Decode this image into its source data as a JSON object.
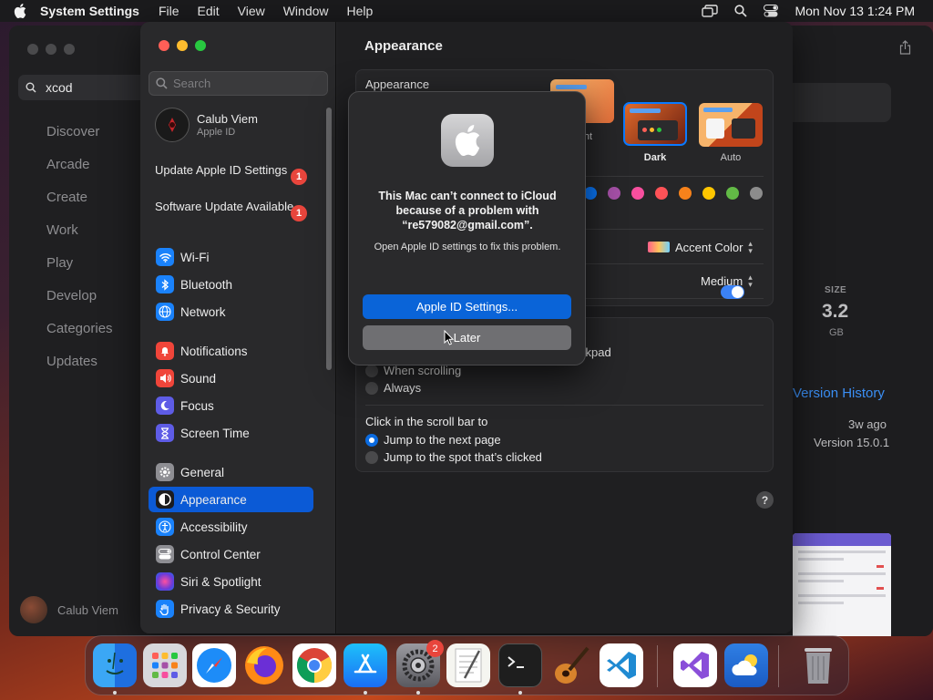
{
  "menubar": {
    "app_name": "System Settings",
    "items": [
      "File",
      "Edit",
      "View",
      "Window",
      "Help"
    ],
    "clock": "Mon Nov 13  1:24 PM"
  },
  "appstore": {
    "search_value": "xcod",
    "nav": [
      "Discover",
      "Arcade",
      "Create",
      "Work",
      "Play",
      "Develop",
      "Categories",
      "Updates"
    ],
    "user_name": "Calub Viem",
    "size_label": "SIZE",
    "size_value": "3.2",
    "size_unit": "GB",
    "version_history": "Version History",
    "time_ago": "3w ago",
    "version": "Version 15.0.1"
  },
  "settings": {
    "search_placeholder": "Search",
    "account_name": "Calub Viem",
    "account_sub": "Apple ID",
    "notices": [
      {
        "label": "Update Apple ID Settings",
        "badge": "1"
      },
      {
        "label": "Software Update Available",
        "badge": "1"
      }
    ],
    "sidebar": [
      {
        "label": "Wi-Fi",
        "icon": "wifi-icon",
        "color": "#1a82fb"
      },
      {
        "label": "Bluetooth",
        "icon": "bluetooth-icon",
        "color": "#1a82fb"
      },
      {
        "label": "Network",
        "icon": "globe-icon",
        "color": "#1a82fb"
      },
      {
        "label": "Notifications",
        "icon": "bell-icon",
        "color": "#f0453a"
      },
      {
        "label": "Sound",
        "icon": "speaker-icon",
        "color": "#f0453a"
      },
      {
        "label": "Focus",
        "icon": "moon-icon",
        "color": "#5e5ce6"
      },
      {
        "label": "Screen Time",
        "icon": "hourglass-icon",
        "color": "#5e5ce6"
      },
      {
        "label": "General",
        "icon": "gear-icon",
        "color": "#8e8e93"
      },
      {
        "label": "Appearance",
        "icon": "appearance-icon",
        "color": "#1c1c1e"
      },
      {
        "label": "Accessibility",
        "icon": "accessibility-icon",
        "color": "#1a82fb"
      },
      {
        "label": "Control Center",
        "icon": "control-center-icon",
        "color": "#8e8e93"
      },
      {
        "label": "Siri & Spotlight",
        "icon": "siri-icon",
        "color": "#8a3ab9"
      },
      {
        "label": "Privacy & Security",
        "icon": "hand-icon",
        "color": "#1a82fb"
      }
    ],
    "active": "Appearance",
    "content_title": "Appearance",
    "appearance_label": "Appearance",
    "themes": [
      {
        "label": "Light"
      },
      {
        "label": "Dark"
      },
      {
        "label": "Auto"
      }
    ],
    "accent_colors": [
      "#0a7aff",
      "#a550a7",
      "#f74f9e",
      "#ff5257",
      "#f7821b",
      "#ffc600",
      "#62ba46",
      "#8c8c8c"
    ],
    "highlight_label": "Accent Color",
    "sidebar_icon_size": "Medium",
    "trackpad_fragment": "ckpad",
    "scroll_options": [
      "When scrolling",
      "Always"
    ],
    "click_label": "Click in the scroll bar to",
    "click_options": [
      "Jump to the next page",
      "Jump to the spot that’s clicked"
    ],
    "help": "?"
  },
  "dialog": {
    "title": "This Mac can’t connect to iCloud because of a problem with “re579082@gmail.com”.",
    "message": "Open Apple ID settings to fix this problem.",
    "primary_button": "Apple ID Settings...",
    "secondary_button": "Later"
  },
  "dock": {
    "apps": [
      "Finder",
      "Launchpad",
      "Safari",
      "Firefox",
      "Chrome",
      "App Store",
      "System Settings",
      "TextEdit",
      "Terminal",
      "GarageBand",
      "VS Code",
      "Visual Studio",
      "Weather",
      "Trash"
    ],
    "settings_badge": "2"
  }
}
